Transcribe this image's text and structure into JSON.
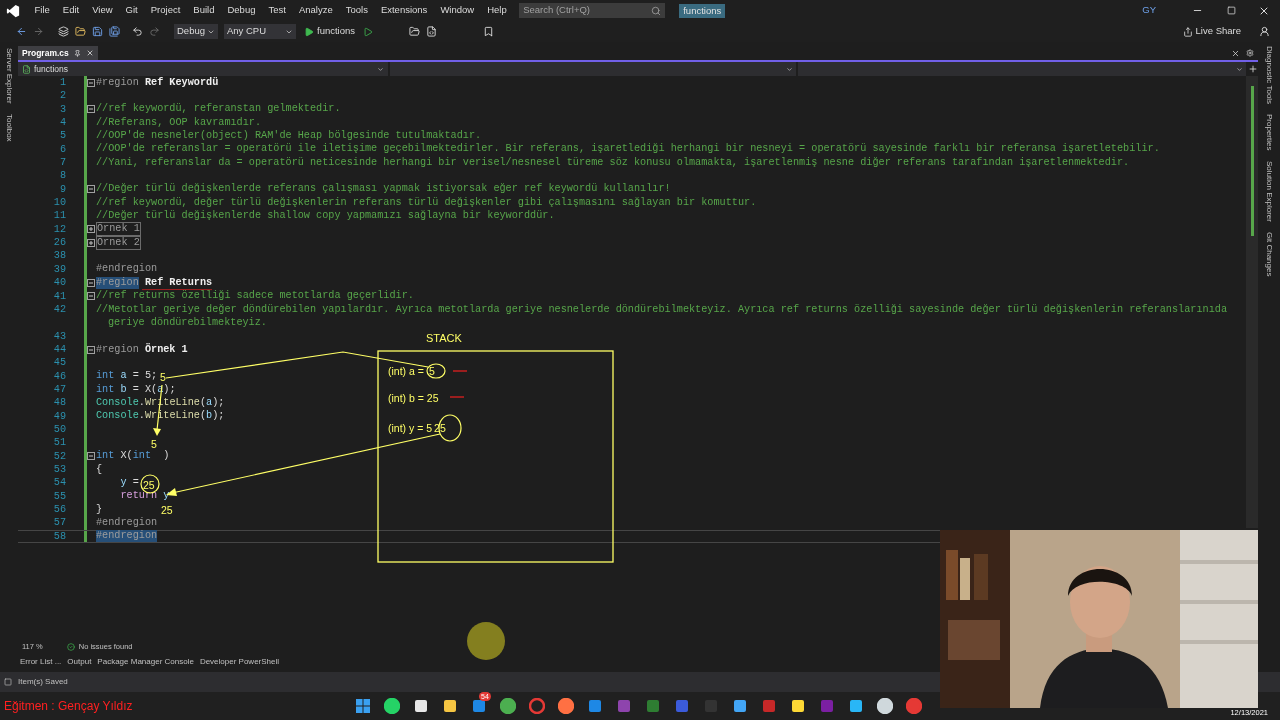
{
  "menu": [
    "File",
    "Edit",
    "View",
    "Git",
    "Project",
    "Build",
    "Debug",
    "Test",
    "Analyze",
    "Tools",
    "Extensions",
    "Window",
    "Help"
  ],
  "search": {
    "placeholder": "Search (Ctrl+Q)"
  },
  "solution_badge": "functions",
  "account": "GY",
  "toolbar": {
    "configuration": "Debug",
    "platform": "Any CPU",
    "start": "functions",
    "live_share": "Live Share"
  },
  "left_tool_tabs": [
    "Server Explorer",
    "Toolbox"
  ],
  "right_tool_tabs": [
    "Diagnostic Tools",
    "Properties",
    "Solution Explorer",
    "Git Changes"
  ],
  "document_tabs": [
    {
      "label": "Program.cs",
      "selected": true
    }
  ],
  "navigation": {
    "project": "functions"
  },
  "code_lines": [
    {
      "number": "1",
      "fold": {
        "expanded": true
      },
      "selected": false,
      "segments": [
        {
          "kind": "directive",
          "text": "#region"
        },
        {
          "kind": "region-name",
          "text": " Ref Keywordü"
        }
      ]
    },
    {
      "number": "2"
    },
    {
      "number": "3",
      "fold": {
        "expanded": true
      },
      "selected": false,
      "segments": [
        {
          "kind": "comment",
          "text": "//ref keywordü, referanstan gelmektedir."
        }
      ]
    },
    {
      "number": "4",
      "selected": false,
      "segments": [
        {
          "kind": "comment",
          "text": "//Referans, OOP kavramıdır."
        }
      ]
    },
    {
      "number": "5",
      "selected": false,
      "segments": [
        {
          "kind": "comment",
          "text": "//OOP'de nesneler(object) RAM'de Heap bölgesinde tutulmaktadır."
        }
      ]
    },
    {
      "number": "6",
      "selected": false,
      "segments": [
        {
          "kind": "comment",
          "text": "//OOP'de referanslar = operatörü ile iletişime geçebilmektedirler. Bir referans, işaretlediği herhangi bir nesneyi = operatörü sayesinde farklı bir referansa işaretletebilir."
        }
      ]
    },
    {
      "number": "7",
      "selected": false,
      "segments": [
        {
          "kind": "comment",
          "text": "//Yani, referanslar da = operatörü neticesinde herhangi bir verisel/nesnesel türeme söz konusu olmamakta, işaretlenmiş nesne diğer referans tarafından işaretlenmektedir."
        }
      ]
    },
    {
      "number": "8"
    },
    {
      "number": "9",
      "fold": {
        "expanded": true
      },
      "selected": false,
      "segments": [
        {
          "kind": "comment",
          "text": "//Değer türlü değişkenlerde referans çalışması yapmak istiyorsak eğer ref keywordü kullanılır!"
        }
      ]
    },
    {
      "number": "10",
      "selected": false,
      "segments": [
        {
          "kind": "comment",
          "text": "//ref keywordü, değer türlü değişkenlerin referans türlü değişkenler gibi çalışmasını sağlayan bir komuttur."
        }
      ]
    },
    {
      "number": "11",
      "selected": false,
      "segments": [
        {
          "kind": "comment",
          "text": "//Değer türlü değişkenlerde shallow copy yapmamızı sağlayna bir keyworddür."
        }
      ]
    },
    {
      "number": "12",
      "fold": {
        "expanded": false
      },
      "selected": false,
      "segments": [
        {
          "kind": "collapsed",
          "text": "Örnek 1"
        }
      ]
    },
    {
      "number": "26",
      "fold": {
        "expanded": false
      },
      "selected": false,
      "segments": [
        {
          "kind": "collapsed",
          "text": "Örnek 2"
        }
      ]
    },
    {
      "number": "38"
    },
    {
      "number": "39",
      "selected": false,
      "segments": [
        {
          "kind": "directive",
          "text": "#endregion"
        }
      ]
    },
    {
      "number": "40",
      "fold": {
        "expanded": true
      },
      "selected": true,
      "segments": [
        {
          "kind": "directive",
          "text": "#region"
        },
        {
          "kind": "region-name",
          "text": " Ref Returns"
        }
      ]
    },
    {
      "number": "41",
      "fold": {
        "expanded": true
      },
      "selected": false,
      "segments": [
        {
          "kind": "comment",
          "text": "//ref returns özelliği sadece metotlarda geçerlidir."
        }
      ]
    },
    {
      "number": "42",
      "selected": false,
      "segments": [
        {
          "kind": "comment",
          "text": "//Metotlar geriye değer döndürebilen yapılardır. Ayrıca metotlarda geriye nesnelerde döndürebilmekteyiz. Ayrıca ref returns özelliği sayesinde değer türlü değişkenlerin referanslarınıda"
        }
      ],
      "wrap": "geriye döndürebilmekteyiz."
    },
    {
      "number": "43"
    },
    {
      "number": "44",
      "fold": {
        "expanded": true
      },
      "selected": false,
      "segments": [
        {
          "kind": "directive",
          "text": "#region"
        },
        {
          "kind": "region-name",
          "text": " Örnek 1"
        }
      ]
    },
    {
      "number": "45"
    },
    {
      "number": "46",
      "selected": false,
      "segments": [
        {
          "kind": "keyword",
          "text": "int"
        },
        {
          "kind": "variable",
          "text": " a"
        },
        {
          "kind": "plain",
          "text": " = 5;"
        }
      ]
    },
    {
      "number": "47",
      "selected": false,
      "segments": [
        {
          "kind": "keyword",
          "text": "int"
        },
        {
          "kind": "variable",
          "text": " b"
        },
        {
          "kind": "plain",
          "text": " = X("
        },
        {
          "kind": "variable",
          "text": "a"
        },
        {
          "kind": "plain",
          "text": ");"
        }
      ]
    },
    {
      "number": "48",
      "selected": false,
      "segments": [
        {
          "kind": "type",
          "text": "Console"
        },
        {
          "kind": "plain",
          "text": "."
        },
        {
          "kind": "method",
          "text": "WriteLine"
        },
        {
          "kind": "plain",
          "text": "("
        },
        {
          "kind": "variable",
          "text": "a"
        },
        {
          "kind": "plain",
          "text": ");"
        }
      ]
    },
    {
      "number": "49",
      "selected": false,
      "segments": [
        {
          "kind": "type",
          "text": "Console"
        },
        {
          "kind": "plain",
          "text": "."
        },
        {
          "kind": "method",
          "text": "WriteLine"
        },
        {
          "kind": "plain",
          "text": "("
        },
        {
          "kind": "variable",
          "text": "b"
        },
        {
          "kind": "plain",
          "text": ");"
        }
      ]
    },
    {
      "number": "50"
    },
    {
      "number": "51"
    },
    {
      "number": "52",
      "fold": {
        "expanded": true
      },
      "selected": false,
      "segments": [
        {
          "kind": "keyword",
          "text": "int"
        },
        {
          "kind": "plain",
          "text": " X("
        },
        {
          "kind": "keyword",
          "text": "int"
        },
        {
          "kind": "plain",
          "text": "  )"
        }
      ]
    },
    {
      "number": "53",
      "selected": false,
      "segments": [
        {
          "kind": "plain",
          "text": "{"
        }
      ]
    },
    {
      "number": "54",
      "selected": false,
      "segments": [
        {
          "kind": "variable",
          "text": "    y"
        },
        {
          "kind": "plain",
          "text": " ="
        }
      ]
    },
    {
      "number": "55",
      "selected": false,
      "segments": [
        {
          "kind": "control",
          "text": "    return"
        },
        {
          "kind": "variable",
          "text": " y"
        }
      ]
    },
    {
      "number": "56",
      "selected": false,
      "segments": [
        {
          "kind": "plain",
          "text": "}"
        }
      ]
    },
    {
      "number": "57",
      "selected": false,
      "segments": [
        {
          "kind": "directive",
          "text": "#endregion"
        }
      ]
    },
    {
      "number": "58",
      "selected": true,
      "segments": [
        {
          "kind": "directive",
          "text": "#endregion"
        }
      ]
    }
  ],
  "annotations": {
    "title": "STACK",
    "stack_entries": [
      {
        "label": "(int) a =",
        "value": "5"
      },
      {
        "label": "(int) b = 25"
      },
      {
        "label": "(int) y = 5",
        "value": "25"
      }
    ],
    "notes": [
      "5",
      "5",
      "25",
      "25"
    ]
  },
  "editor_status": {
    "zoom": "117 %",
    "issues": "No issues found"
  },
  "tool_window_tabs": [
    "Error List ...",
    "Output",
    "Package Manager Console",
    "Developer PowerShell"
  ],
  "status_bar": {
    "message": "Item(s) Saved"
  },
  "caption": "Eğitmen : Gençay Yıldız",
  "taskbar": {
    "mail_badge": "54",
    "date": "12/13/2021"
  },
  "webcam": {
    "kind": "picture"
  }
}
